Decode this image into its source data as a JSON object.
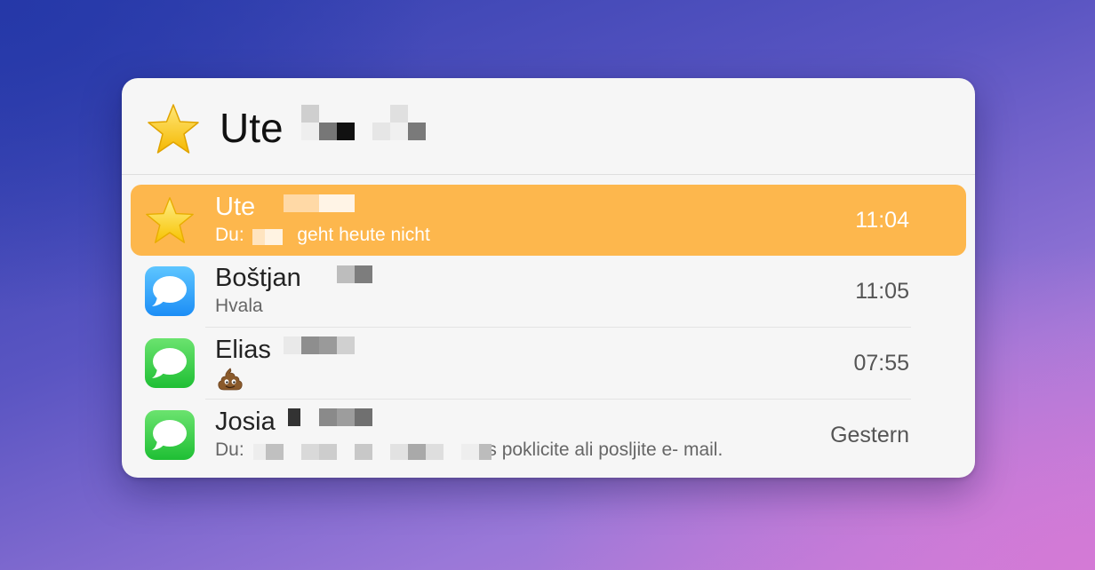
{
  "header": {
    "title": "Ute",
    "icon": "star-icon"
  },
  "colors": {
    "selected_row": "#fdb74d",
    "panel_bg": "#f6f6f6",
    "messages_blue": "#1c8ef6",
    "messages_green": "#1fbf34"
  },
  "conversations": [
    {
      "name": "Ute",
      "preview_prefix": "Du:",
      "preview": "geht heute nicht",
      "time": "11:04",
      "icon": "star-icon",
      "selected": true
    },
    {
      "name": "Boštjan",
      "preview": "Hvala",
      "time": "11:05",
      "icon": "messages-blue-icon",
      "selected": false
    },
    {
      "name": "Elias",
      "preview": "💩",
      "time": "07:55",
      "icon": "messages-green-icon",
      "selected": false
    },
    {
      "name": "Josia",
      "preview_prefix": "Du:",
      "preview": ".s poklicite ali posljite e- mail.",
      "time": "Gestern",
      "icon": "messages-green-icon",
      "selected": false
    }
  ]
}
